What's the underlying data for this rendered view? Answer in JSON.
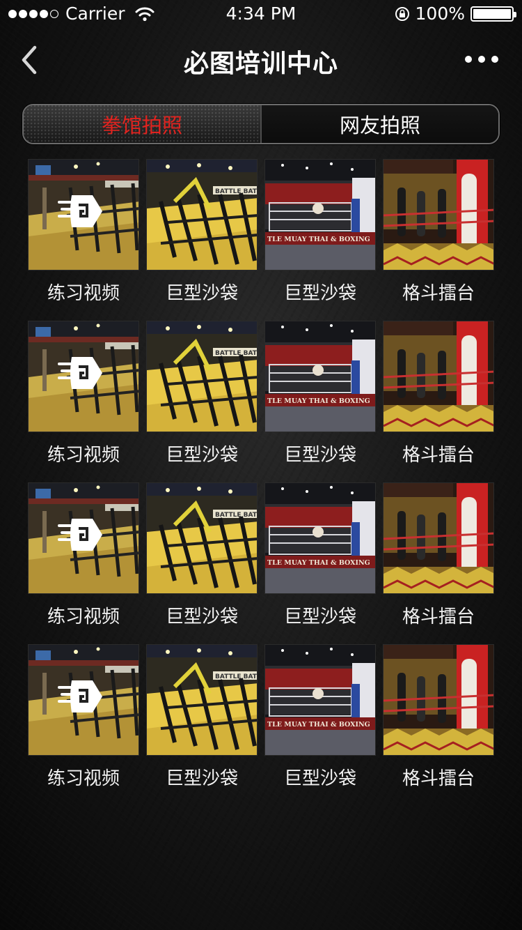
{
  "status_bar": {
    "carrier": "Carrier",
    "time": "4:34 PM",
    "battery": "100%",
    "battery_level": 1.0,
    "signal_bars": 4,
    "icons": [
      "signal-dots-icon",
      "wifi-icon",
      "orientation-lock-icon",
      "battery-icon"
    ]
  },
  "navbar": {
    "title": "必图培训中心",
    "back_icon": "chevron-left-icon",
    "more_icon": "more-dots-icon"
  },
  "tabs": [
    {
      "label": "拳馆拍照",
      "active": true
    },
    {
      "label": "网友拍照",
      "active": false
    }
  ],
  "colors": {
    "accent": "#e0231f",
    "background": "#141414",
    "text": "#ffffff"
  },
  "grid": {
    "rows": [
      [
        {
          "caption": "练习视频",
          "kind": "gym",
          "video": true
        },
        {
          "caption": "巨型沙袋",
          "kind": "machines",
          "video": false
        },
        {
          "caption": "巨型沙袋",
          "kind": "ring",
          "video": false
        },
        {
          "caption": "格斗擂台",
          "kind": "bags",
          "video": false
        }
      ],
      [
        {
          "caption": "练习视频",
          "kind": "gym",
          "video": true
        },
        {
          "caption": "巨型沙袋",
          "kind": "machines",
          "video": false
        },
        {
          "caption": "巨型沙袋",
          "kind": "ring",
          "video": false
        },
        {
          "caption": "格斗擂台",
          "kind": "bags",
          "video": false
        }
      ],
      [
        {
          "caption": "练习视频",
          "kind": "gym",
          "video": true
        },
        {
          "caption": "巨型沙袋",
          "kind": "machines",
          "video": false
        },
        {
          "caption": "巨型沙袋",
          "kind": "ring",
          "video": false
        },
        {
          "caption": "格斗擂台",
          "kind": "bags",
          "video": false
        }
      ],
      [
        {
          "caption": "练习视频",
          "kind": "gym",
          "video": true
        },
        {
          "caption": "巨型沙袋",
          "kind": "machines",
          "video": false
        },
        {
          "caption": "巨型沙袋",
          "kind": "ring",
          "video": false
        },
        {
          "caption": "格斗擂台",
          "kind": "bags",
          "video": false
        }
      ]
    ],
    "play_icon": "video-play-icon",
    "banner_text": "TLE MUAY THAI & BOXING",
    "sign_text": "BATTLE BATTLE"
  }
}
